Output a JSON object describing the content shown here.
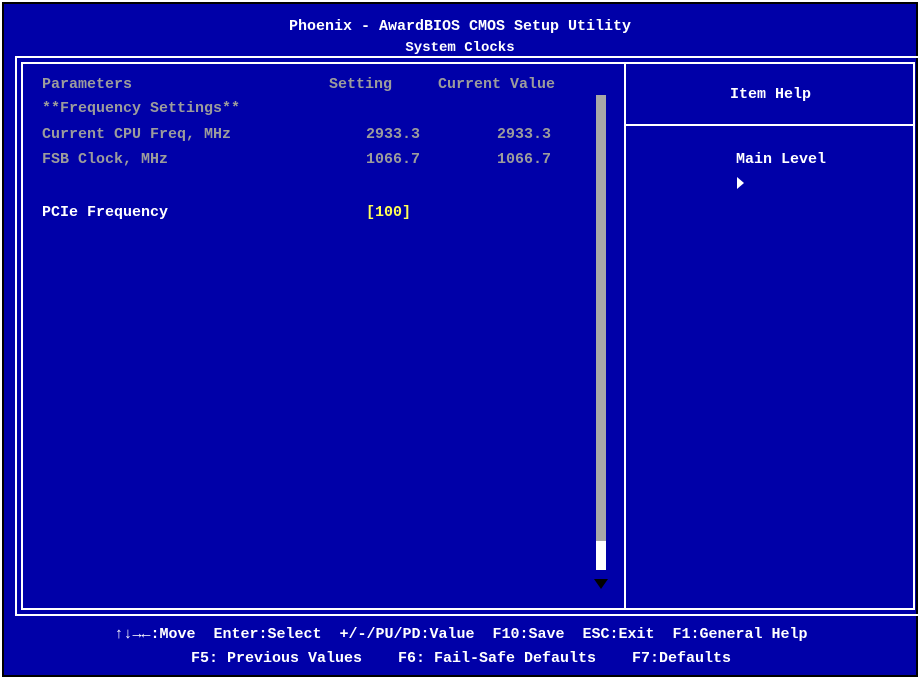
{
  "header": {
    "title": "Phoenix - AwardBIOS CMOS Setup Utility",
    "subtitle": "System Clocks"
  },
  "columns": {
    "parameters": "Parameters",
    "setting": "Setting",
    "current_value": "Current Value"
  },
  "section": "**Frequency Settings**",
  "rows": [
    {
      "label": "Current CPU Freq, MHz",
      "setting": "2933.3",
      "current": "2933.3"
    },
    {
      "label": "FSB Clock, MHz",
      "setting": "1066.7",
      "current": "1066.7"
    }
  ],
  "pcie": {
    "label": "PCIe Frequency",
    "value": "[100]"
  },
  "help": {
    "title": "Item Help",
    "main_level": "Main Level"
  },
  "footer": {
    "line1": "↑↓→←:Move  Enter:Select  +/-/PU/PD:Value  F10:Save  ESC:Exit  F1:General Help",
    "line2": "F5: Previous Values    F6: Fail-Safe Defaults    F7:Defaults"
  },
  "colors": {
    "background": "#0000a8",
    "disabled_text": "#9c9c9c",
    "selected_value": "#ffff54",
    "text": "#ffffff"
  },
  "icons": {
    "help_pointer": "triangle-right-icon",
    "scroll_down": "triangle-down-icon"
  }
}
